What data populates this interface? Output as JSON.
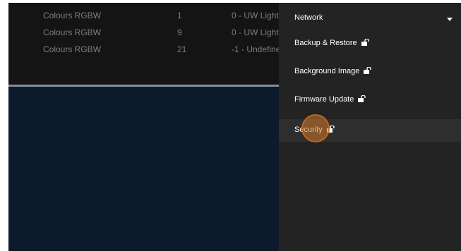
{
  "table": {
    "rows": [
      {
        "type": "Colours RGBW",
        "id": "1",
        "name": "0 - UW Light"
      },
      {
        "type": "Colours RGBW",
        "id": "9",
        "name": "0 - UW Light"
      },
      {
        "type": "Colours RGBW",
        "id": "21",
        "name": "-1 - Undefine"
      }
    ]
  },
  "menu": {
    "items": [
      {
        "label": "Network",
        "icon": "chevron-down-icon"
      },
      {
        "label": "Backup & Restore",
        "icon": "unlock-icon"
      },
      {
        "label": "Background Image",
        "icon": "unlock-icon"
      },
      {
        "label": "Firmware Update",
        "icon": "unlock-icon"
      },
      {
        "label": "Security",
        "icon": "unlock-icon"
      }
    ]
  },
  "colors": {
    "menu_bg": "#232323",
    "table_bg": "#141414",
    "content_bg": "#0c1a2c",
    "divider": "#7d8fa3",
    "touch_indicator": "#d27828"
  }
}
